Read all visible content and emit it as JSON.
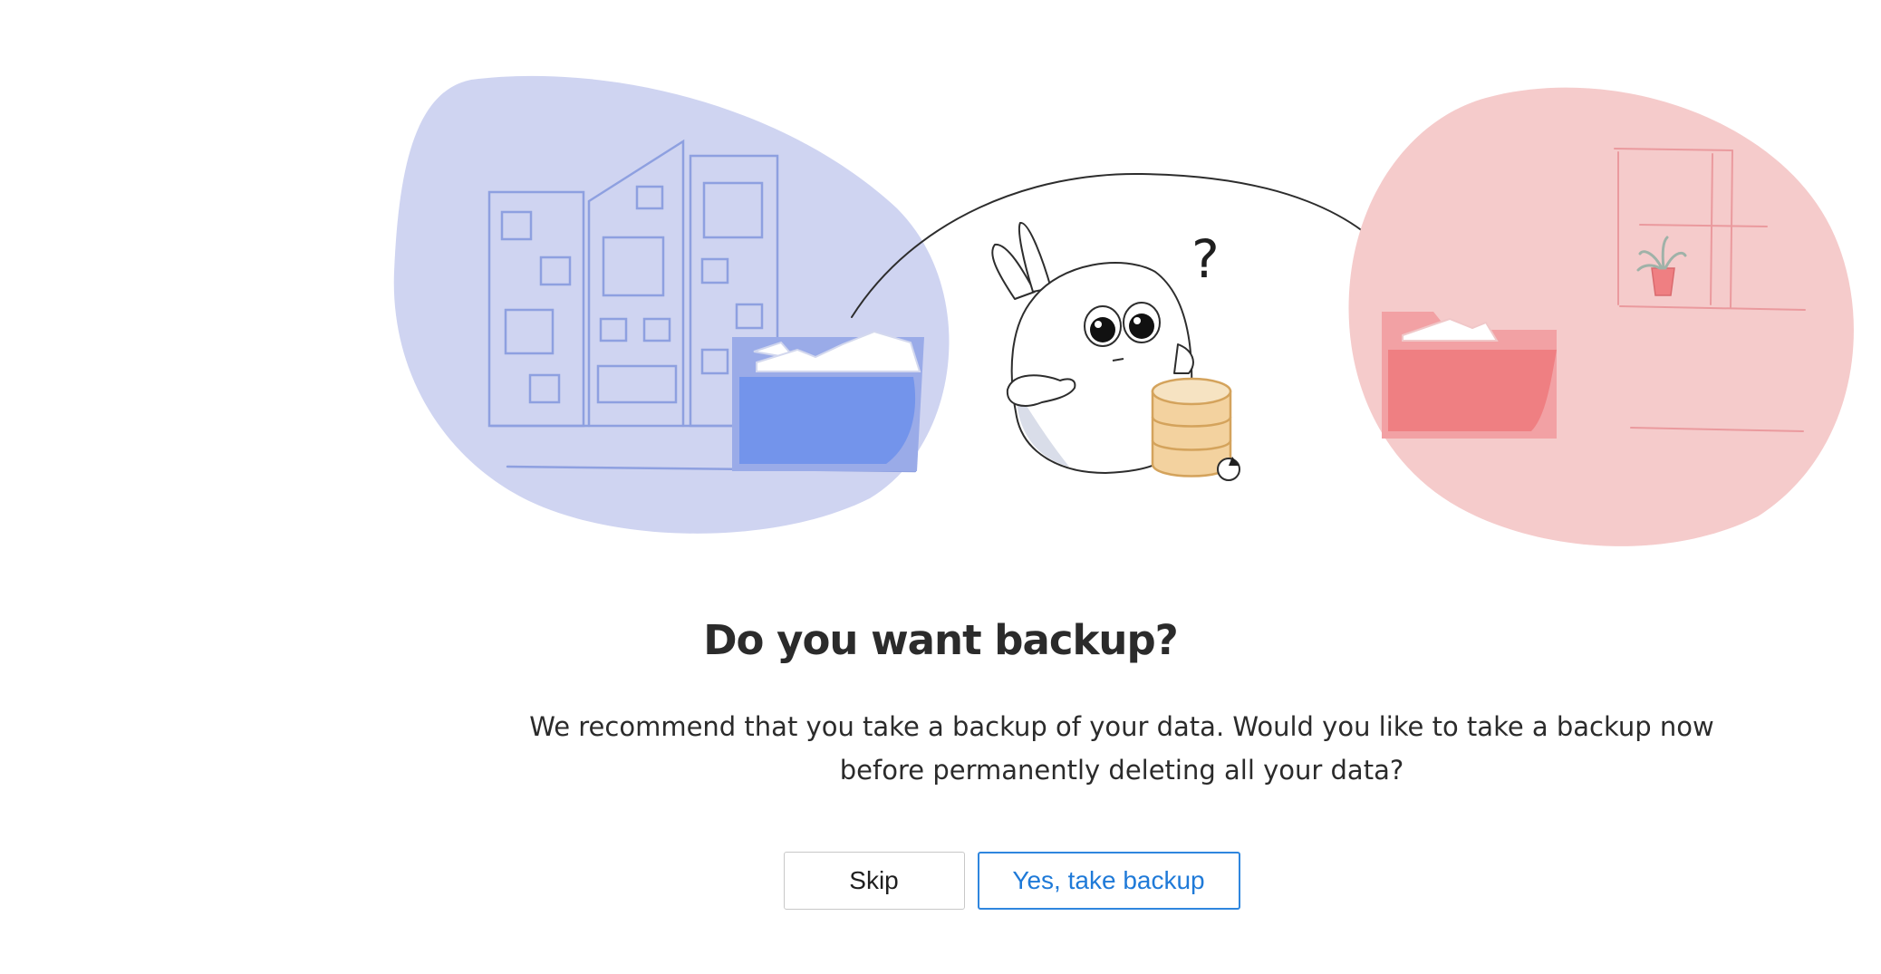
{
  "dialog": {
    "title": "Do you want backup?",
    "description": "We recommend that you take a backup of your data. Would you like to take a backup now before permanently deleting all your data?",
    "skip_label": "Skip",
    "confirm_label": "Yes, take backup"
  },
  "illustration": {
    "question_mark": "?",
    "icons": [
      "office-buildings-icon",
      "blue-folder-icon",
      "database-icon",
      "mascot-icon",
      "red-folder-icon",
      "window-icon",
      "potted-plant-icon",
      "transfer-arrow-icon"
    ]
  },
  "colors": {
    "left_blob": "#cfd4f1",
    "right_blob": "#f5cbcb",
    "blue_folder": "#7394eb",
    "red_folder": "#ef7f82",
    "database": "#f3d29f",
    "primary": "#1f7ad8"
  }
}
